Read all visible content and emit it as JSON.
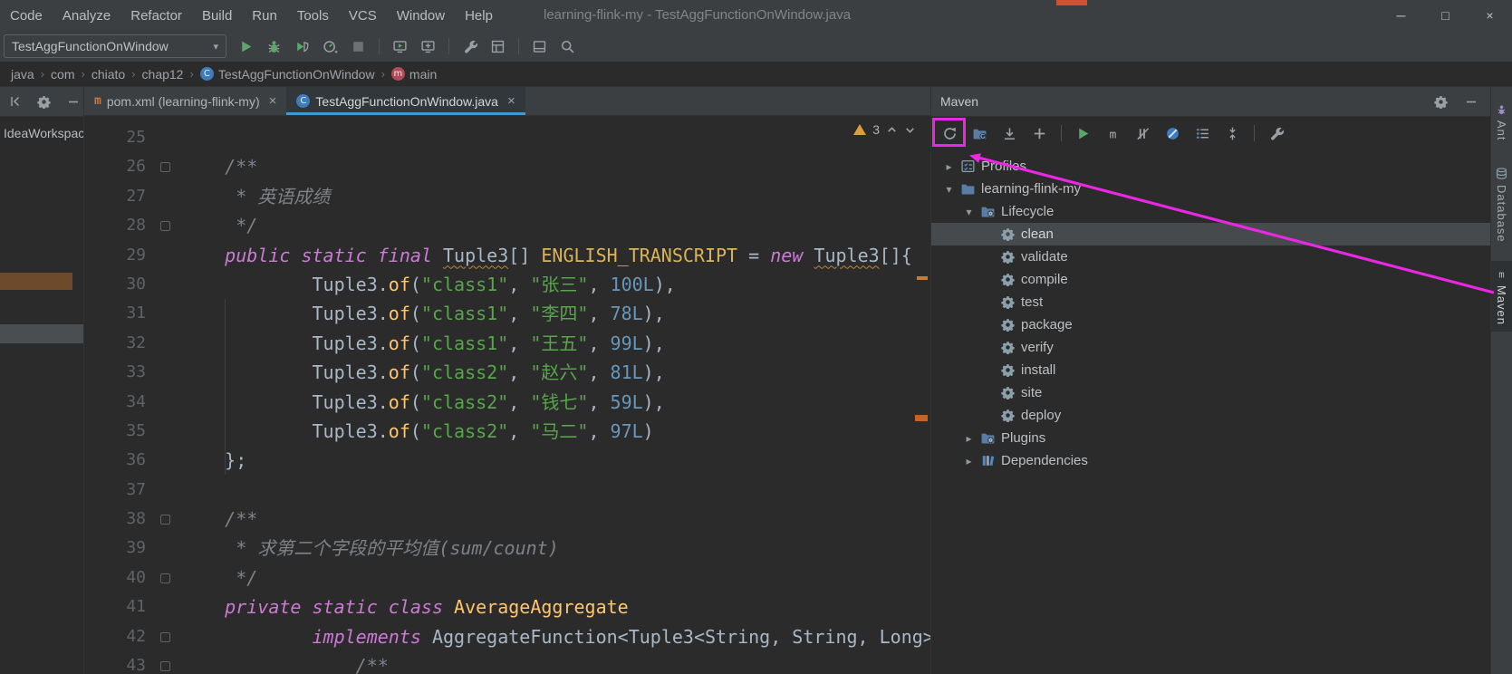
{
  "window": {
    "menus": [
      "Code",
      "Analyze",
      "Refactor",
      "Build",
      "Run",
      "Tools",
      "VCS",
      "Window",
      "Help"
    ],
    "title": "learning-flink-my - TestAggFunctionOnWindow.java",
    "controls": [
      "minimize",
      "maximize",
      "close"
    ]
  },
  "toolbar": {
    "run_config": "TestAggFunctionOnWindow",
    "buttons": [
      "run",
      "debug",
      "run-with-coverage",
      "profiler",
      "stop",
      "sep",
      "monitor-run",
      "monitor-add",
      "sep",
      "settings-wrench",
      "project-structure",
      "sep",
      "layout",
      "search-everywhere"
    ]
  },
  "breadcrumbs": [
    {
      "label": "java"
    },
    {
      "label": "com"
    },
    {
      "label": "chiato"
    },
    {
      "label": "chap12"
    },
    {
      "label": "TestAggFunctionOnWindow",
      "icon": "class"
    },
    {
      "label": "main",
      "icon": "method"
    }
  ],
  "left_panel": {
    "workspace_label": "IdeaWorkspac"
  },
  "tabs": [
    {
      "label": "pom.xml (learning-flink-my)",
      "icon": "maven",
      "close": "×",
      "active": false
    },
    {
      "label": "TestAggFunctionOnWindow.java",
      "icon": "class",
      "close": "×",
      "active": true
    }
  ],
  "editor": {
    "warning_count": "3",
    "lines": [
      {
        "n": "25",
        "s": []
      },
      {
        "n": "26",
        "fold": true,
        "s": [
          [
            "cmt",
            "    /**"
          ]
        ]
      },
      {
        "n": "27",
        "s": [
          [
            "cmt",
            "     * 英语成绩"
          ]
        ]
      },
      {
        "n": "28",
        "fold": true,
        "s": [
          [
            "cmt",
            "     */"
          ]
        ]
      },
      {
        "n": "29",
        "s": [
          [
            "kw",
            "    public static final "
          ],
          [
            "uerr",
            "Tuple3"
          ],
          [
            "pln",
            "[] "
          ],
          [
            "fld",
            "ENGLISH_TRANSCRIPT"
          ],
          [
            "pln",
            " = "
          ],
          [
            "kw",
            "new "
          ],
          [
            "uerr",
            "Tuple3"
          ],
          [
            "pln",
            "[]{"
          ]
        ]
      },
      {
        "n": "30",
        "s": [
          [
            "pln",
            "            Tuple3."
          ],
          [
            "mth",
            "of"
          ],
          [
            "pln",
            "("
          ],
          [
            "str",
            "\"class1\""
          ],
          [
            "pln",
            ", "
          ],
          [
            "str",
            "\"张三\""
          ],
          [
            "pln",
            ", "
          ],
          [
            "num",
            "100L"
          ],
          [
            "pln",
            "),"
          ]
        ]
      },
      {
        "n": "31",
        "s": [
          [
            "pln",
            "            Tuple3."
          ],
          [
            "mth",
            "of"
          ],
          [
            "pln",
            "("
          ],
          [
            "str",
            "\"class1\""
          ],
          [
            "pln",
            ", "
          ],
          [
            "str",
            "\"李四\""
          ],
          [
            "pln",
            ", "
          ],
          [
            "num",
            "78L"
          ],
          [
            "pln",
            "),"
          ]
        ]
      },
      {
        "n": "32",
        "s": [
          [
            "pln",
            "            Tuple3."
          ],
          [
            "mth",
            "of"
          ],
          [
            "pln",
            "("
          ],
          [
            "str",
            "\"class1\""
          ],
          [
            "pln",
            ", "
          ],
          [
            "str",
            "\"王五\""
          ],
          [
            "pln",
            ", "
          ],
          [
            "num",
            "99L"
          ],
          [
            "pln",
            "),"
          ]
        ]
      },
      {
        "n": "33",
        "s": [
          [
            "pln",
            "            Tuple3."
          ],
          [
            "mth",
            "of"
          ],
          [
            "pln",
            "("
          ],
          [
            "str",
            "\"class2\""
          ],
          [
            "pln",
            ", "
          ],
          [
            "str",
            "\"赵六\""
          ],
          [
            "pln",
            ", "
          ],
          [
            "num",
            "81L"
          ],
          [
            "pln",
            "),"
          ]
        ]
      },
      {
        "n": "34",
        "s": [
          [
            "pln",
            "            Tuple3."
          ],
          [
            "mth",
            "of"
          ],
          [
            "pln",
            "("
          ],
          [
            "str",
            "\"class2\""
          ],
          [
            "pln",
            ", "
          ],
          [
            "str",
            "\"钱七\""
          ],
          [
            "pln",
            ", "
          ],
          [
            "num",
            "59L"
          ],
          [
            "pln",
            "),"
          ]
        ]
      },
      {
        "n": "35",
        "s": [
          [
            "pln",
            "            Tuple3."
          ],
          [
            "mth",
            "of"
          ],
          [
            "pln",
            "("
          ],
          [
            "str",
            "\"class2\""
          ],
          [
            "pln",
            ", "
          ],
          [
            "str",
            "\"马二\""
          ],
          [
            "pln",
            ", "
          ],
          [
            "num",
            "97L"
          ],
          [
            "pln",
            ")"
          ]
        ]
      },
      {
        "n": "36",
        "s": [
          [
            "pln",
            "    };"
          ]
        ]
      },
      {
        "n": "37",
        "s": []
      },
      {
        "n": "38",
        "fold": true,
        "s": [
          [
            "cmt",
            "    /**"
          ]
        ]
      },
      {
        "n": "39",
        "s": [
          [
            "cmt",
            "     * 求第二个字段的平均值(sum/count)"
          ]
        ]
      },
      {
        "n": "40",
        "fold": true,
        "s": [
          [
            "cmt",
            "     */"
          ]
        ]
      },
      {
        "n": "41",
        "s": [
          [
            "kw",
            "    private static class "
          ],
          [
            "cls",
            "AverageAggregate"
          ]
        ]
      },
      {
        "n": "42",
        "fold": true,
        "s": [
          [
            "kw",
            "            implements "
          ],
          [
            "pln",
            "AggregateFunction<Tuple3<String, String, Long>"
          ]
        ]
      },
      {
        "n": "43",
        "fold": true,
        "s": [
          [
            "cmt",
            "                /**"
          ]
        ]
      }
    ]
  },
  "maven": {
    "title": "Maven",
    "header_buttons": [
      "gear",
      "minimize"
    ],
    "toolbar": [
      "reimport",
      "generate-sources",
      "download-sources",
      "add-maven-project",
      "sep",
      "execute-goal",
      "maven-run-config",
      "toggle-skip-tests",
      "toggle-offline",
      "show-dependencies",
      "collapse-all",
      "sep",
      "maven-settings"
    ],
    "tree": [
      {
        "label": "Profiles",
        "depth": 0,
        "chevron": "closed",
        "icon": "profiles"
      },
      {
        "label": "learning-flink-my",
        "depth": 0,
        "chevron": "open",
        "icon": "module"
      },
      {
        "label": "Lifecycle",
        "depth": 1,
        "chevron": "open",
        "icon": "lifecycle"
      },
      {
        "label": "clean",
        "depth": 2,
        "icon": "goal",
        "selected": true
      },
      {
        "label": "validate",
        "depth": 2,
        "icon": "goal"
      },
      {
        "label": "compile",
        "depth": 2,
        "icon": "goal"
      },
      {
        "label": "test",
        "depth": 2,
        "icon": "goal"
      },
      {
        "label": "package",
        "depth": 2,
        "icon": "goal"
      },
      {
        "label": "verify",
        "depth": 2,
        "icon": "goal"
      },
      {
        "label": "install",
        "depth": 2,
        "icon": "goal"
      },
      {
        "label": "site",
        "depth": 2,
        "icon": "goal"
      },
      {
        "label": "deploy",
        "depth": 2,
        "icon": "goal"
      },
      {
        "label": "Plugins",
        "depth": 1,
        "chevron": "closed",
        "icon": "lifecycle"
      },
      {
        "label": "Dependencies",
        "depth": 1,
        "chevron": "closed",
        "icon": "deps"
      }
    ]
  },
  "left_header_buttons": [
    "hide-left",
    "gear",
    "minimize"
  ],
  "right_stripe": [
    {
      "label": "Ant",
      "icon": "ant",
      "active": false
    },
    {
      "label": "Database",
      "icon": "database",
      "active": false
    },
    {
      "label": "Maven",
      "icon": "maven-m",
      "active": true
    }
  ],
  "colors": {
    "annotation": "#E928E4",
    "tab_underline": "#3D9AD2",
    "tree_selection": "#464A4D",
    "keyword": "#CC7AD6",
    "string": "#57A64A",
    "number": "#6897BB",
    "run_green": "#59A869"
  }
}
